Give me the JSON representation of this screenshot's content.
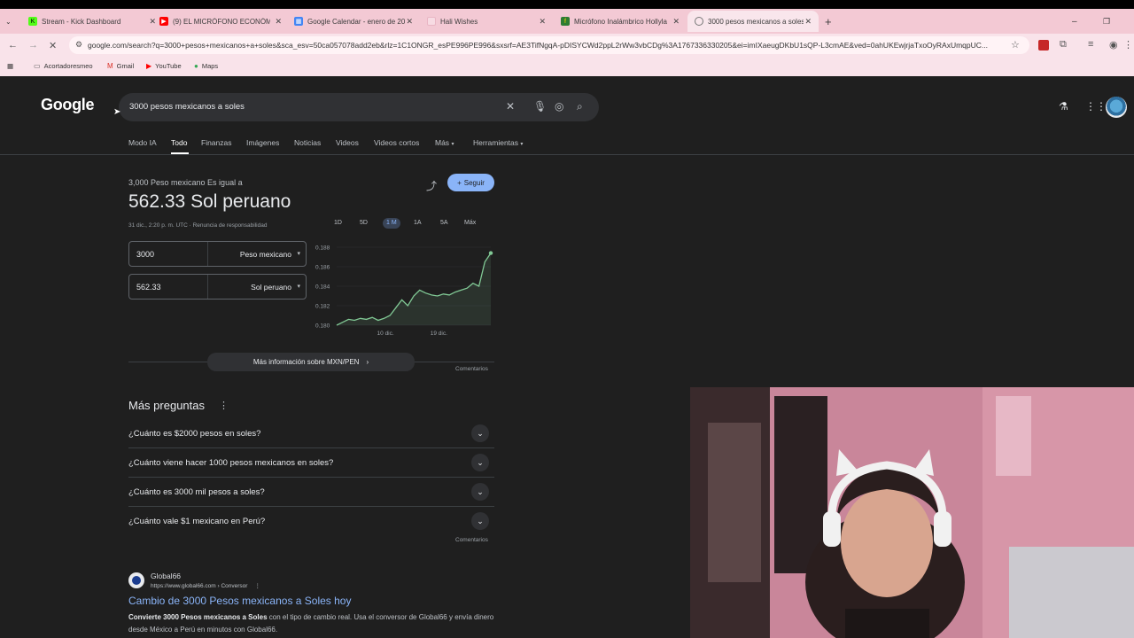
{
  "browser": {
    "tabs": [
      {
        "label": "Stream - Kick Dashboard",
        "color": "#53fc18"
      },
      {
        "label": "(9) EL MICRÓFONO ECONÓMI",
        "color": "#ff0000"
      },
      {
        "label": "Google Calendar - enero de 20",
        "color": "#4285f4"
      },
      {
        "label": "Hali Wishes",
        "color": "#f0b7c6"
      },
      {
        "label": "Micrófono Inalámbrico Hollyla",
        "color": "#f7c600"
      },
      {
        "label": "3000 pesos mexicanos a soles",
        "color": "#9aa0a6"
      }
    ],
    "new_tab": "+",
    "url": "google.com/search?q=3000+pesos+mexicanos+a+soles&sca_esv=50ca057078add2eb&rlz=1C1ONGR_esPE996PE996&sxsrf=AE3TifNgqA-pDISYCWd2ppL2rWw3vbCDg%3A1767336330205&ei=imIXaeugDKbU1sQP-L3cmAE&ved=0ahUKEwjrjaTxoOyRAxUmqpUC...",
    "bookmarks": [
      {
        "label": "Acortadoresmeo",
        "icon": "folder-icon"
      },
      {
        "label": "Gmail",
        "icon": "gmail-icon"
      },
      {
        "label": "YouTube",
        "icon": "youtube-icon"
      },
      {
        "label": "Maps",
        "icon": "maps-icon"
      }
    ]
  },
  "google": {
    "logo": "Google",
    "query": "3000 pesos mexicanos a soles",
    "tabs": [
      {
        "label": "Modo IA"
      },
      {
        "label": "Todo"
      },
      {
        "label": "Finanzas"
      },
      {
        "label": "Imágenes"
      },
      {
        "label": "Noticias"
      },
      {
        "label": "Videos"
      },
      {
        "label": "Videos cortos"
      },
      {
        "label": "Más"
      },
      {
        "label": "Herramientas"
      }
    ]
  },
  "converter": {
    "equals_label": "3,000 Peso mexicano Es igual a",
    "result": "562.33 Sol peruano",
    "meta": "31 dic., 2:20 p. m. UTC · Renuncia de responsabilidad",
    "follow": "Seguir",
    "ranges": [
      "1D",
      "5D",
      "1 M",
      "1A",
      "5A",
      "Máx"
    ],
    "from_value": "3000",
    "from_currency": "Peso mexicano",
    "to_value": "562.33",
    "to_currency": "Sol peruano",
    "more_info": "Más información sobre MXN/PEN",
    "feedback": "Comentarios"
  },
  "chart_data": {
    "type": "line",
    "title": "",
    "xlabel": "",
    "ylabel": "",
    "ylim": [
      0.18,
      0.188
    ],
    "y_ticks": [
      "0.188",
      "0.186",
      "0.184",
      "0.182",
      "0.180"
    ],
    "x_ticks": [
      "10 dic.",
      "19 dic."
    ],
    "series": [
      {
        "values": [
          0.18,
          0.1803,
          0.1806,
          0.1805,
          0.1807,
          0.1806,
          0.1808,
          0.1805,
          0.1807,
          0.181,
          0.1818,
          0.1826,
          0.182,
          0.183,
          0.1836,
          0.1833,
          0.1831,
          0.183,
          0.1832,
          0.1831,
          0.1834,
          0.1836,
          0.1838,
          0.1843,
          0.184,
          0.1865,
          0.1874
        ]
      }
    ],
    "color": "#81c995"
  },
  "paa": {
    "title": "Más preguntas",
    "items": [
      "¿Cuánto es $2000 pesos en soles?",
      "¿Cuánto viene hacer 1000 pesos mexicanos en soles?",
      "¿Cuánto es 3000 mil pesos a soles?",
      "¿Cuánto vale $1 mexicano en Perú?"
    ],
    "feedback": "Comentarios"
  },
  "result": {
    "site": "Global66",
    "url": "https://www.global66.com › Conversor",
    "title": "Cambio de 3000 Pesos mexicanos a Soles hoy",
    "snippet_bold": "Convierte 3000 Pesos mexicanos a Soles",
    "snippet_rest": " con el tipo de cambio real. Usa el conversor de Global66 y envía dinero desde México a Perú en minutos con Global66."
  }
}
